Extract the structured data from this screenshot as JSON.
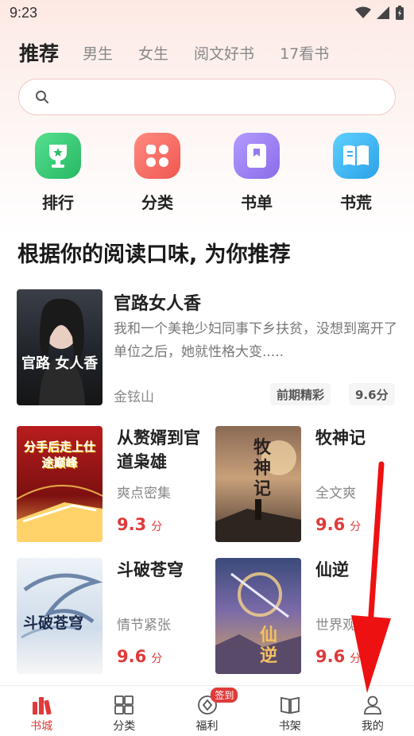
{
  "status_bar": {
    "time": "9:23"
  },
  "tabs": [
    {
      "label": "推荐",
      "active": true
    },
    {
      "label": "男生",
      "active": false
    },
    {
      "label": "女生",
      "active": false
    },
    {
      "label": "阅文好书",
      "active": false
    },
    {
      "label": "17看书",
      "active": false
    }
  ],
  "search": {
    "placeholder": ""
  },
  "quick_entries": [
    {
      "label": "排行",
      "icon": "trophy-icon",
      "color": "#3ccf7a"
    },
    {
      "label": "分类",
      "icon": "category-icon",
      "color": "#f5706a"
    },
    {
      "label": "书单",
      "icon": "booklist-icon",
      "color": "#9a7cf2"
    },
    {
      "label": "书荒",
      "icon": "open-book-icon",
      "color": "#3fb4ee"
    }
  ],
  "section": {
    "title": "根据你的阅读口味, 为你推荐"
  },
  "featured": {
    "title": "官路女人香",
    "description": "我和一个美艳少妇同事下乡扶贫，没想到离开了单位之后，她就性格大变.....",
    "author": "金铉山",
    "tag": "前期精彩",
    "score": "9.6分",
    "cover_text": "官路 女人香"
  },
  "grid_books": [
    {
      "title": "从赘婿到官道枭雄",
      "subtitle": "爽点密集",
      "score": "9.3",
      "unit": "分",
      "cover_text": "分手后走上仕途巅峰"
    },
    {
      "title": "牧神记",
      "subtitle": "全文爽",
      "score": "9.6",
      "unit": "分",
      "cover_text": "牧神记"
    },
    {
      "title": "斗破苍穹",
      "subtitle": "情节紧张",
      "score": "9.6",
      "unit": "分",
      "cover_text": "斗破苍穹"
    },
    {
      "title": "仙逆",
      "subtitle": "世界观清晰",
      "score": "9.6",
      "unit": "分",
      "cover_text": "仙逆"
    }
  ],
  "bottom_nav": [
    {
      "label": "书城",
      "icon": "bookstore-icon",
      "active": true
    },
    {
      "label": "分类",
      "icon": "grid-icon",
      "active": false
    },
    {
      "label": "福利",
      "icon": "coin-icon",
      "active": false,
      "badge": "签到"
    },
    {
      "label": "书架",
      "icon": "bookshelf-icon",
      "active": false
    },
    {
      "label": "我的",
      "icon": "profile-icon",
      "active": false
    }
  ],
  "colors": {
    "accent": "#e03a3a",
    "annotation": "#ee1111"
  }
}
